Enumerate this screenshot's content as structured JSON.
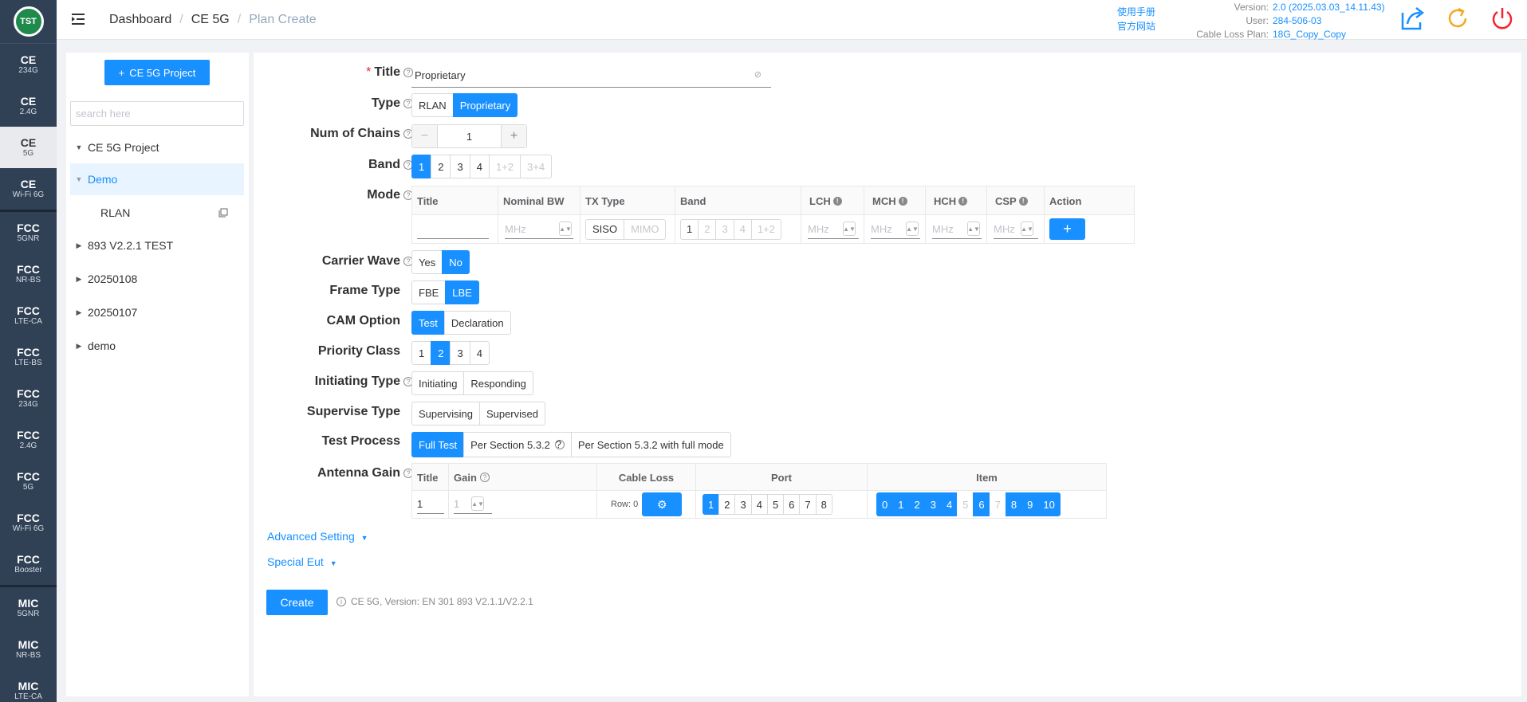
{
  "nav": {
    "logo": "TST",
    "items": [
      {
        "t": "CE",
        "s": "234G"
      },
      {
        "t": "CE",
        "s": "2.4G"
      },
      {
        "t": "CE",
        "s": "5G"
      },
      {
        "t": "CE",
        "s": "Wi-Fi 6G"
      },
      {
        "t": "FCC",
        "s": "5GNR"
      },
      {
        "t": "FCC",
        "s": "NR-BS"
      },
      {
        "t": "FCC",
        "s": "LTE-CA"
      },
      {
        "t": "FCC",
        "s": "LTE-BS"
      },
      {
        "t": "FCC",
        "s": "234G"
      },
      {
        "t": "FCC",
        "s": "2.4G"
      },
      {
        "t": "FCC",
        "s": "5G"
      },
      {
        "t": "FCC",
        "s": "Wi-Fi 6G"
      },
      {
        "t": "FCC",
        "s": "Booster"
      },
      {
        "t": "MIC",
        "s": "5GNR"
      },
      {
        "t": "MIC",
        "s": "NR-BS"
      },
      {
        "t": "MIC",
        "s": "LTE-CA"
      }
    ]
  },
  "header": {
    "breadcrumb": [
      "Dashboard",
      "CE 5G",
      "Plan Create"
    ],
    "links": [
      "使用手册",
      "官方网站"
    ],
    "version_label": "Version:",
    "version": "2.0 (2025.03.03_14.11.43)",
    "user_label": "User:",
    "user": "284-506-03",
    "plan_label": "Cable Loss Plan:",
    "plan": "18G_Copy_Copy"
  },
  "sidebar": {
    "add_button": "CE 5G Project",
    "search_placeholder": "search here",
    "tree": [
      "CE 5G Project",
      "Demo",
      "RLAN",
      "893 V2.2.1 TEST",
      "20250108",
      "20250107",
      "demo"
    ]
  },
  "form": {
    "title_label": "Title",
    "title_value": "Proprietary",
    "type_label": "Type",
    "type_opts": [
      "RLAN",
      "Proprietary"
    ],
    "chains_label": "Num of Chains",
    "chains_value": "1",
    "minus": "−",
    "plus": "+",
    "band_label": "Band",
    "band_opts": [
      "1",
      "2",
      "3",
      "4",
      "1+2",
      "3+4"
    ],
    "mode_label": "Mode",
    "mode_headers": [
      "Title",
      "Nominal BW",
      "TX Type",
      "Band",
      "LCH",
      "MCH",
      "HCH",
      "CSP",
      "Action"
    ],
    "mhz": "MHz",
    "tx_opts": [
      "SISO",
      "MIMO"
    ],
    "mode_band_opts": [
      "1",
      "2",
      "3",
      "4",
      "1+2"
    ],
    "add": "+",
    "carrier_label": "Carrier Wave",
    "carrier_opts": [
      "Yes",
      "No"
    ],
    "frame_label": "Frame Type",
    "frame_opts": [
      "FBE",
      "LBE"
    ],
    "cam_label": "CAM Option",
    "cam_opts": [
      "Test",
      "Declaration"
    ],
    "priority_label": "Priority Class",
    "priority_opts": [
      "1",
      "2",
      "3",
      "4"
    ],
    "init_label": "Initiating Type",
    "init_opts": [
      "Initiating",
      "Responding"
    ],
    "sup_label": "Supervise Type",
    "sup_opts": [
      "Supervising",
      "Supervised"
    ],
    "proc_label": "Test Process",
    "proc_opts": [
      "Full Test",
      "Per Section 5.3.2",
      "Per Section 5.3.2 with full mode"
    ],
    "gain_label": "Antenna Gain",
    "gain_headers": [
      "Title",
      "Gain",
      "Cable Loss",
      "Port",
      "Item"
    ],
    "gain_title": "1",
    "gain_value": "1",
    "row_label": "Row: 0",
    "ports": [
      "1",
      "2",
      "3",
      "4",
      "5",
      "6",
      "7",
      "8"
    ],
    "items": [
      "0",
      "1",
      "2",
      "3",
      "4",
      "5",
      "6",
      "7",
      "8",
      "9",
      "10"
    ],
    "advanced": "Advanced Setting",
    "special": "Special Eut",
    "create": "Create",
    "note": "CE 5G, Version: EN 301 893 V2.1.1/V2.2.1"
  }
}
